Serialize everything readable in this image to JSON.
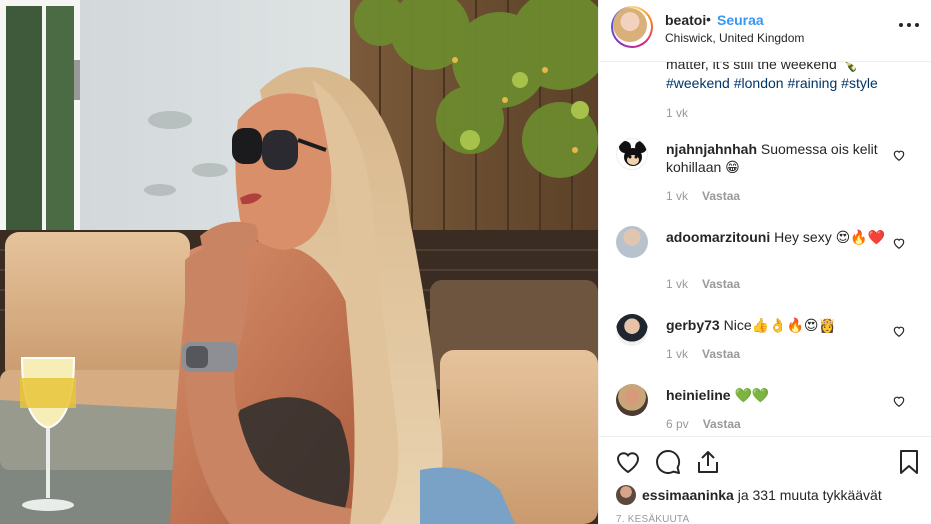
{
  "post": {
    "username": "beatoi",
    "dot": "•",
    "follow_label": "Seuraa",
    "location": "Chiswick, United Kingdom"
  },
  "caption": {
    "cut_line": "matter, it's still the weekend 🍾",
    "hashtags": [
      "#weekend",
      "#london",
      "#raining",
      "#style"
    ],
    "time": "1 vk"
  },
  "comments": [
    {
      "username": "njahnjahnhah",
      "text": "Suomessa ois kelit kohillaan 😁",
      "time": "1 vk",
      "reply_label": "Vastaa",
      "avatar_icon": "mickey-mouse-avatar"
    },
    {
      "username": "adoomarzitouni",
      "text": "Hey sexy 😍🔥❤️",
      "time": "1 vk",
      "reply_label": "Vastaa",
      "avatar_icon": "person-avatar"
    },
    {
      "username": "gerby73",
      "text": "Nice👍👌🔥😍👸",
      "time": "1 vk",
      "reply_label": "Vastaa",
      "avatar_icon": "person-avatar"
    },
    {
      "username": "heinieline",
      "text": "💚💚",
      "time": "6 pv",
      "reply_label": "Vastaa",
      "avatar_icon": "person-avatar"
    }
  ],
  "likes": {
    "username": "essimaaninka",
    "rest": " ja 331 muuta tykkäävät"
  },
  "date": "7. KESÄKUUTA",
  "colors": {
    "link": "#3897f0",
    "hashtag": "#003569",
    "meta": "#999999",
    "border": "#efefef"
  }
}
